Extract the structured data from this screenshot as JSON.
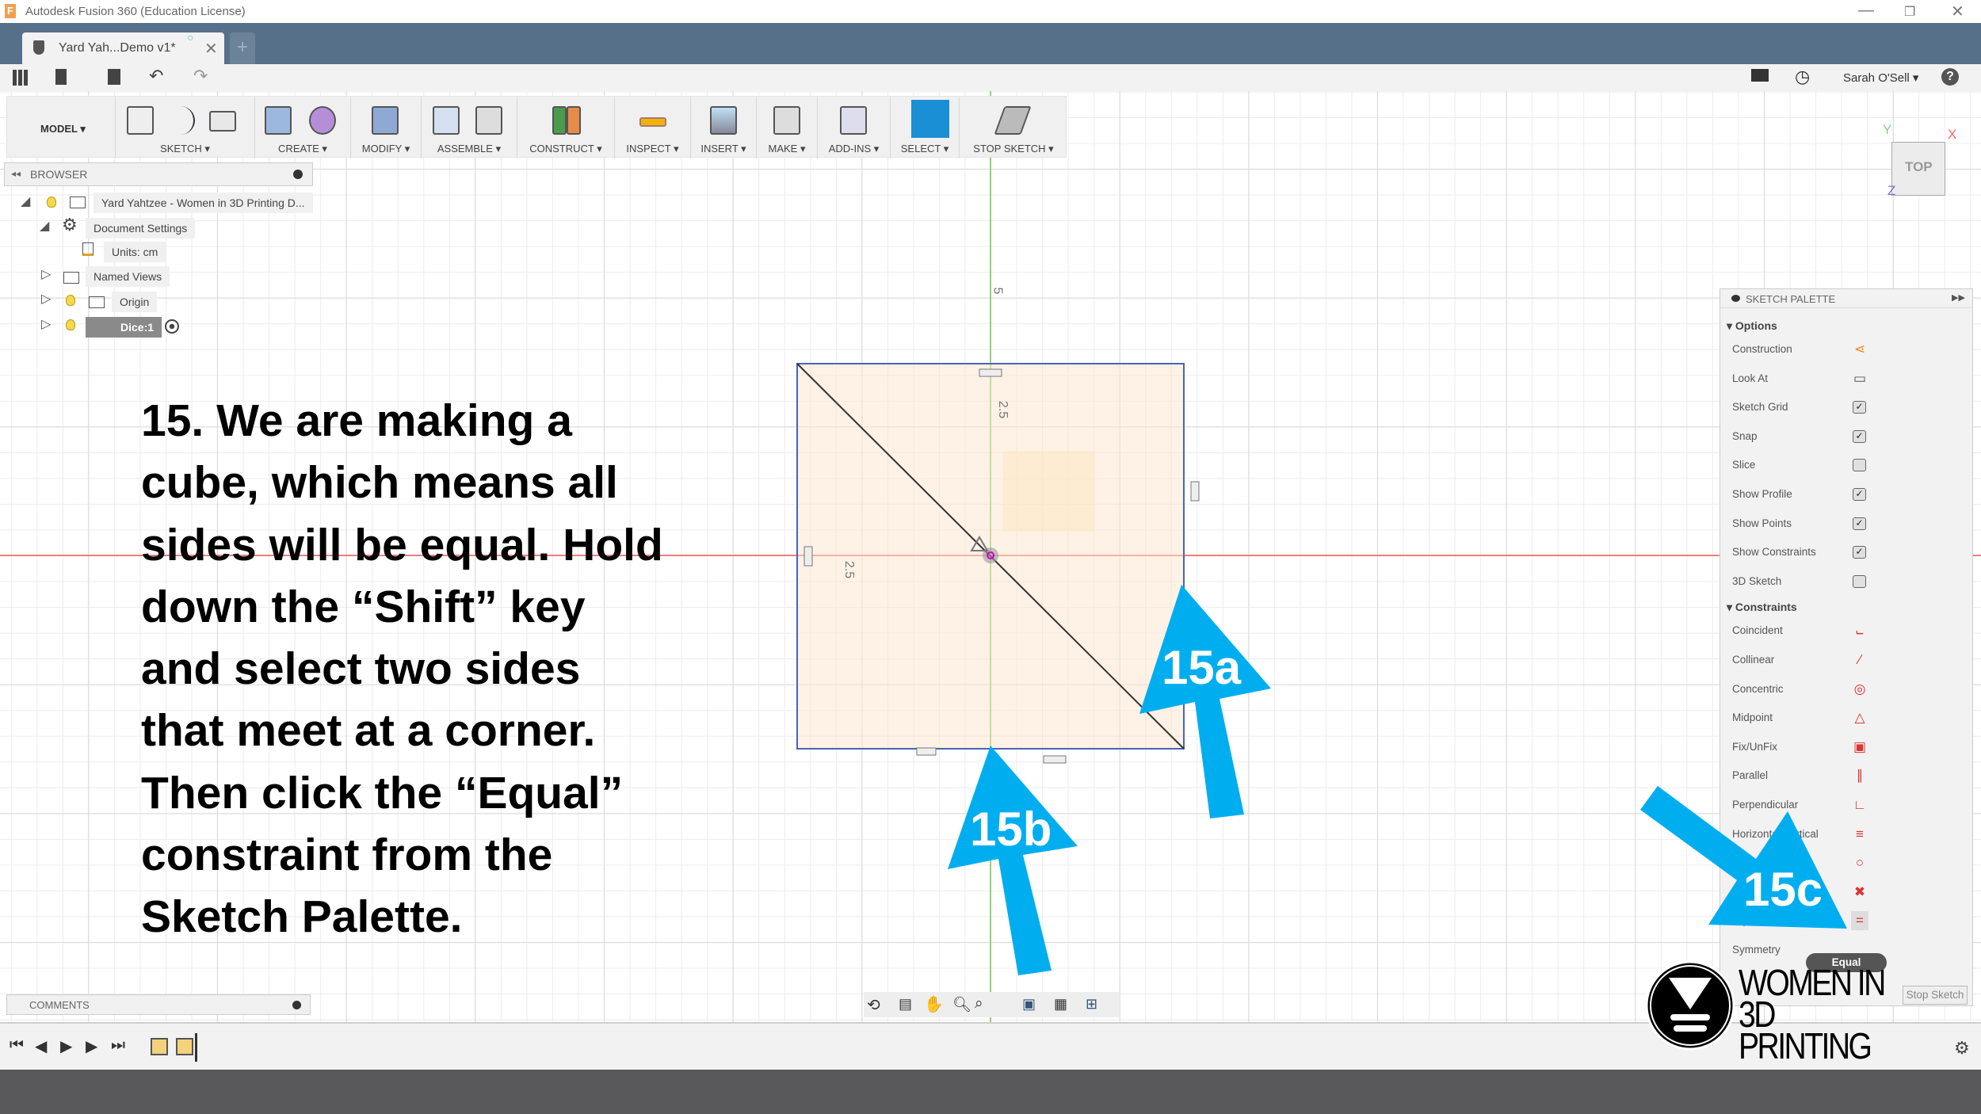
{
  "window": {
    "title": "Autodesk Fusion 360 (Education License)",
    "app_icon": "F"
  },
  "tabs": [
    {
      "label": "Yard Yah...Demo v1*"
    }
  ],
  "header": {
    "user": "Sarah O'Sell ▾",
    "help": "?"
  },
  "toolbar": {
    "workspace": "MODEL ▾",
    "groups": [
      "SKETCH ▾",
      "CREATE ▾",
      "MODIFY ▾",
      "ASSEMBLE ▾",
      "CONSTRUCT ▾",
      "INSPECT ▾",
      "INSERT ▾",
      "MAKE ▾",
      "ADD-INS ▾",
      "SELECT ▾",
      "STOP SKETCH ▾"
    ]
  },
  "browser": {
    "title": "BROWSER",
    "items": [
      "Yard Yahtzee - Women in 3D Printing D...",
      "Document Settings",
      "Units: cm",
      "Named Views",
      "Origin",
      "Dice:1"
    ]
  },
  "viewcube": {
    "face": "TOP",
    "x": "X",
    "y": "Y",
    "z": "Z"
  },
  "sketch": {
    "dims": [
      "5",
      "2.5",
      "2.5"
    ]
  },
  "instruction": {
    "lines": [
      "15. We are making a",
      "cube, which means all",
      "sides will be equal. Hold",
      "down the “Shift” key",
      "and select two sides",
      "that meet at a corner.",
      "Then click the “Equal”",
      "constraint from the",
      "Sketch Palette."
    ]
  },
  "callouts": {
    "a": "15a",
    "b": "15b",
    "c": "15c",
    "color": "#00aeef"
  },
  "palette": {
    "title": "SKETCH PALETTE",
    "options_title": "Options",
    "options": [
      {
        "label": "Construction",
        "icon": "construction-icon"
      },
      {
        "label": "Look At",
        "icon": "look-at-icon"
      },
      {
        "label": "Sketch Grid",
        "checked": true
      },
      {
        "label": "Snap",
        "checked": true
      },
      {
        "label": "Slice",
        "checked": false
      },
      {
        "label": "Show Profile",
        "checked": true
      },
      {
        "label": "Show Points",
        "checked": true
      },
      {
        "label": "Show Constraints",
        "checked": true
      },
      {
        "label": "3D Sketch",
        "checked": false
      }
    ],
    "constraints_title": "Constraints",
    "constraints": [
      {
        "label": "Coincident",
        "icon": "coincident-icon",
        "glyph": "⨽"
      },
      {
        "label": "Collinear",
        "icon": "collinear-icon",
        "glyph": "∕"
      },
      {
        "label": "Concentric",
        "icon": "concentric-icon",
        "glyph": "◎"
      },
      {
        "label": "Midpoint",
        "icon": "midpoint-icon",
        "glyph": "△"
      },
      {
        "label": "Fix/UnFix",
        "icon": "lock-icon",
        "glyph": "▣"
      },
      {
        "label": "Parallel",
        "icon": "parallel-icon",
        "glyph": "∥"
      },
      {
        "label": "Perpendicular",
        "icon": "perpendicular-icon",
        "glyph": "∟"
      },
      {
        "label": "Horizontal/Vertical",
        "icon": "horizontal-vertical-icon",
        "glyph": "≡"
      },
      {
        "label": "",
        "icon": "tangent-icon",
        "glyph": "○"
      },
      {
        "label": "",
        "icon": "smooth-icon",
        "glyph": "✖"
      },
      {
        "label": "Equal",
        "icon": "equal-icon",
        "glyph": "="
      },
      {
        "label": "Symmetry",
        "icon": "symmetry-icon",
        "glyph": ""
      }
    ],
    "tooltip": "Equal",
    "stop_sketch": "Stop Sketch"
  },
  "comments": {
    "title": "COMMENTS"
  },
  "logo": {
    "text_line1": "WOMEN IN",
    "text_line2": "3D PRINTING"
  }
}
